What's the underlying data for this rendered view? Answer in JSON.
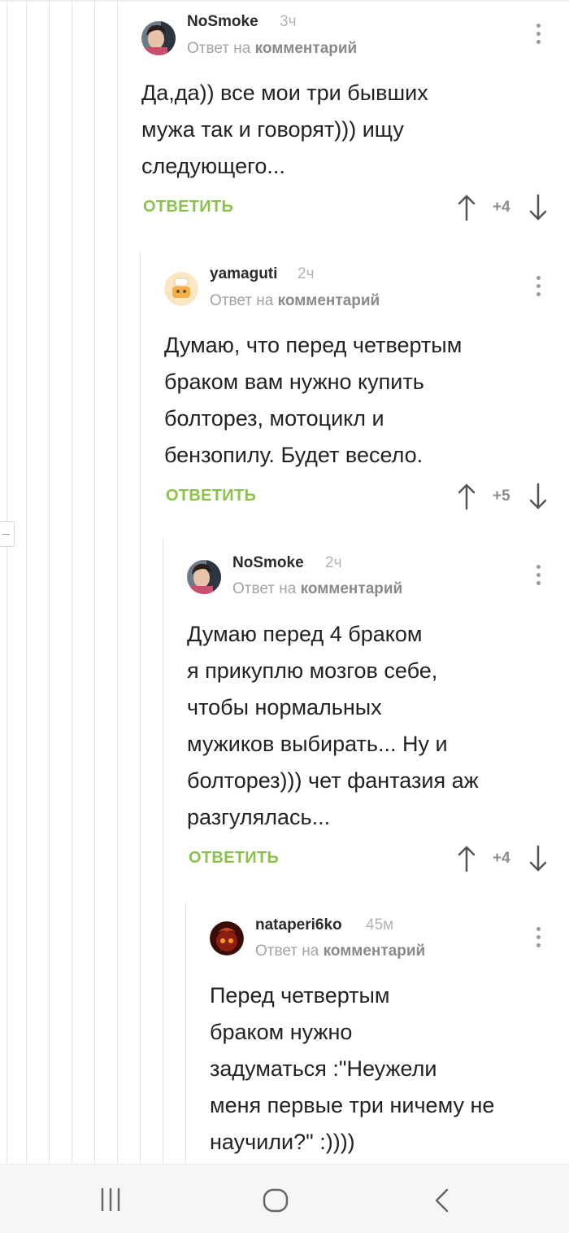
{
  "comments": [
    {
      "author": "NoSmoke",
      "time": "3ч",
      "reply_prefix": "Ответ на",
      "reply_link": "комментарий",
      "text": "Да,да)) все мои три бывших\nмужа так и говорят))) ищу\nследующего...",
      "reply_label": "ОТВЕТИТЬ",
      "score": "+4",
      "avatar": "woman-photo-avatar"
    },
    {
      "author": "yamaguti",
      "time": "2ч",
      "reply_prefix": "Ответ на",
      "reply_link": "комментарий",
      "text": "Думаю, что перед четвертым\nбраком вам нужно купить\nболторез, мотоцикл и\nбензопилу. Будет весело.",
      "reply_label": "ОТВЕТИТЬ",
      "score": "+5",
      "avatar": "cartoon-avatar"
    },
    {
      "author": "NoSmoke",
      "time": "2ч",
      "reply_prefix": "Ответ на",
      "reply_link": "комментарий",
      "text": "Думаю перед 4 браком\nя прикуплю мозгов себе,\nчтобы нормальных\nмужиков выбирать... Ну и\nболторез))) чет фантазия аж\nразгулялась...",
      "reply_label": "ОТВЕТИТЬ",
      "score": "+4",
      "avatar": "woman-photo-avatar"
    },
    {
      "author": "nataperi6ko",
      "time": "45м",
      "reply_prefix": "Ответ на",
      "reply_link": "комментарий",
      "text": "Перед четвертым\nбраком нужно\nзадуматься :\"Неужели\nменя первые три ничему не\nнаучили?\" :))))",
      "avatar": "dark-red-avatar"
    }
  ],
  "navbar": {
    "recents": "recents-icon",
    "home": "home-icon",
    "back": "back-icon"
  },
  "colors": {
    "reply_green": "#8bc34a",
    "thread_line": "#e4e4e4",
    "muted_text": "#a3a3a3"
  }
}
